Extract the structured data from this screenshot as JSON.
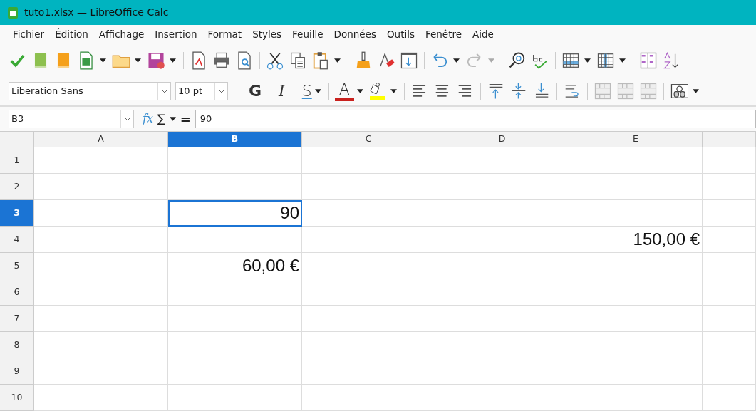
{
  "window": {
    "title": "tuto1.xlsx — LibreOffice Calc"
  },
  "menu": [
    "Fichier",
    "Édition",
    "Affichage",
    "Insertion",
    "Format",
    "Styles",
    "Feuille",
    "Données",
    "Outils",
    "Fenêtre",
    "Aide"
  ],
  "formatting": {
    "font": "Liberation Sans",
    "size": "10 pt",
    "bold": "G",
    "italic": "I",
    "underline": "S",
    "font_color": "A"
  },
  "formula_bar": {
    "name_box": "B3",
    "function_icon": "fx",
    "sum": "∑",
    "equals": "=",
    "value": "90"
  },
  "columns": [
    {
      "label": "A",
      "selected": false
    },
    {
      "label": "B",
      "selected": true
    },
    {
      "label": "C",
      "selected": false
    },
    {
      "label": "D",
      "selected": false
    },
    {
      "label": "E",
      "selected": false
    }
  ],
  "rows": [
    {
      "label": "1",
      "selected": false,
      "cells": [
        null,
        null,
        null,
        null,
        null
      ]
    },
    {
      "label": "2",
      "selected": false,
      "cells": [
        null,
        null,
        null,
        null,
        null
      ]
    },
    {
      "label": "3",
      "selected": true,
      "cells": [
        null,
        "90",
        null,
        null,
        null
      ]
    },
    {
      "label": "4",
      "selected": false,
      "cells": [
        null,
        null,
        null,
        null,
        "150,00 €"
      ]
    },
    {
      "label": "5",
      "selected": false,
      "cells": [
        null,
        "60,00 €",
        null,
        null,
        null
      ]
    },
    {
      "label": "6",
      "selected": false,
      "cells": [
        null,
        null,
        null,
        null,
        null
      ]
    },
    {
      "label": "7",
      "selected": false,
      "cells": [
        null,
        null,
        null,
        null,
        null
      ]
    },
    {
      "label": "8",
      "selected": false,
      "cells": [
        null,
        null,
        null,
        null,
        null
      ]
    },
    {
      "label": "9",
      "selected": false,
      "cells": [
        null,
        null,
        null,
        null,
        null
      ]
    },
    {
      "label": "10",
      "selected": false,
      "cells": [
        null,
        null,
        null,
        null,
        null
      ]
    }
  ]
}
